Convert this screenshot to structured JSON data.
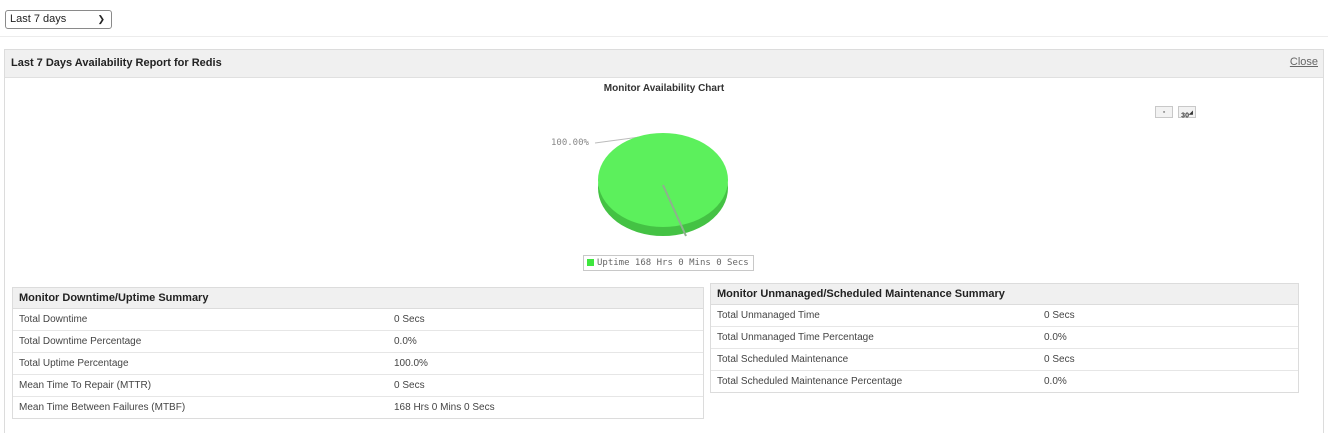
{
  "toolbar": {
    "period_value": "Last 7 days"
  },
  "report": {
    "title": "Last 7 Days Availability Report for Redis",
    "close_label": "Close",
    "chart_title": "Monitor Availability Chart",
    "chart_button_2": "30"
  },
  "chart_data": {
    "type": "pie",
    "title": "Monitor Availability Chart",
    "slices": [
      {
        "name": "Uptime 168 Hrs 0 Mins 0 Secs",
        "value": 100.0,
        "color": "#55ee55"
      }
    ],
    "data_label": "100.00%",
    "legend": "Uptime 168 Hrs 0 Mins 0 Secs",
    "legend_position": "bottom"
  },
  "downtime_summary": {
    "title": "Monitor Downtime/Uptime Summary",
    "rows": [
      {
        "label": "Total Downtime",
        "value": "0 Secs"
      },
      {
        "label": "Total Downtime Percentage",
        "value": "0.0%"
      },
      {
        "label": "Total Uptime Percentage",
        "value": "100.0%"
      },
      {
        "label": "Mean Time To Repair (MTTR)",
        "value": "0 Secs"
      },
      {
        "label": "Mean Time Between Failures (MTBF)",
        "value": "168 Hrs 0 Mins 0 Secs"
      }
    ]
  },
  "maintenance_summary": {
    "title": "Monitor Unmanaged/Scheduled Maintenance Summary",
    "rows": [
      {
        "label": "Total Unmanaged Time",
        "value": "0 Secs"
      },
      {
        "label": "Total Unmanaged Time Percentage",
        "value": "0.0%"
      },
      {
        "label": "Total Scheduled Maintenance",
        "value": "0 Secs"
      },
      {
        "label": "Total Scheduled Maintenance Percentage",
        "value": "0.0%"
      }
    ]
  }
}
